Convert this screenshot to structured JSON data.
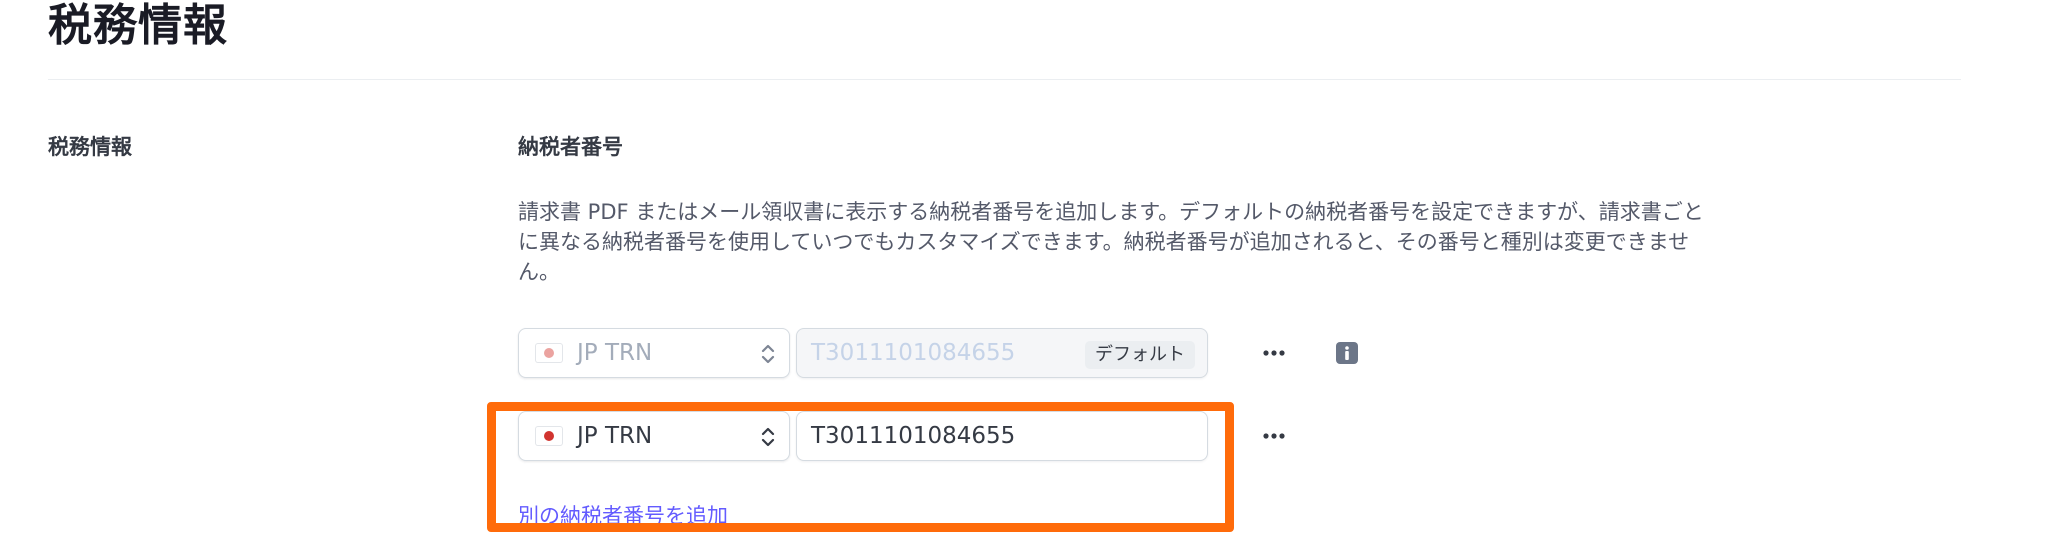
{
  "page": {
    "title": "税務情報"
  },
  "section": {
    "label": "税務情報",
    "field_title": "納税者番号",
    "description": "請求書 PDF またはメール領収書に表示する納税者番号を追加します。デフォルトの納税者番号を設定できますが、請求書ごとに異なる納税者番号を使用していつでもカスタマイズできます。納税者番号が追加されると、その番号と種別は変更できません。"
  },
  "tax_ids": [
    {
      "type": "JP TRN",
      "value": "T3011101084655",
      "badge": "デフォルト",
      "disabled": true
    },
    {
      "type": "JP TRN",
      "value": "T3011101084655",
      "disabled": false
    }
  ],
  "actions": {
    "add_link": "別の納税者番号を追加"
  },
  "icons": {
    "flag": "japan-flag-icon",
    "chevrons": "chevron-up-down-icon",
    "more": "more-horizontal-icon",
    "info": "info-icon"
  },
  "colors": {
    "accent": "#635bff",
    "highlight": "#ff6b0a",
    "flag_red": "#d1342f"
  }
}
